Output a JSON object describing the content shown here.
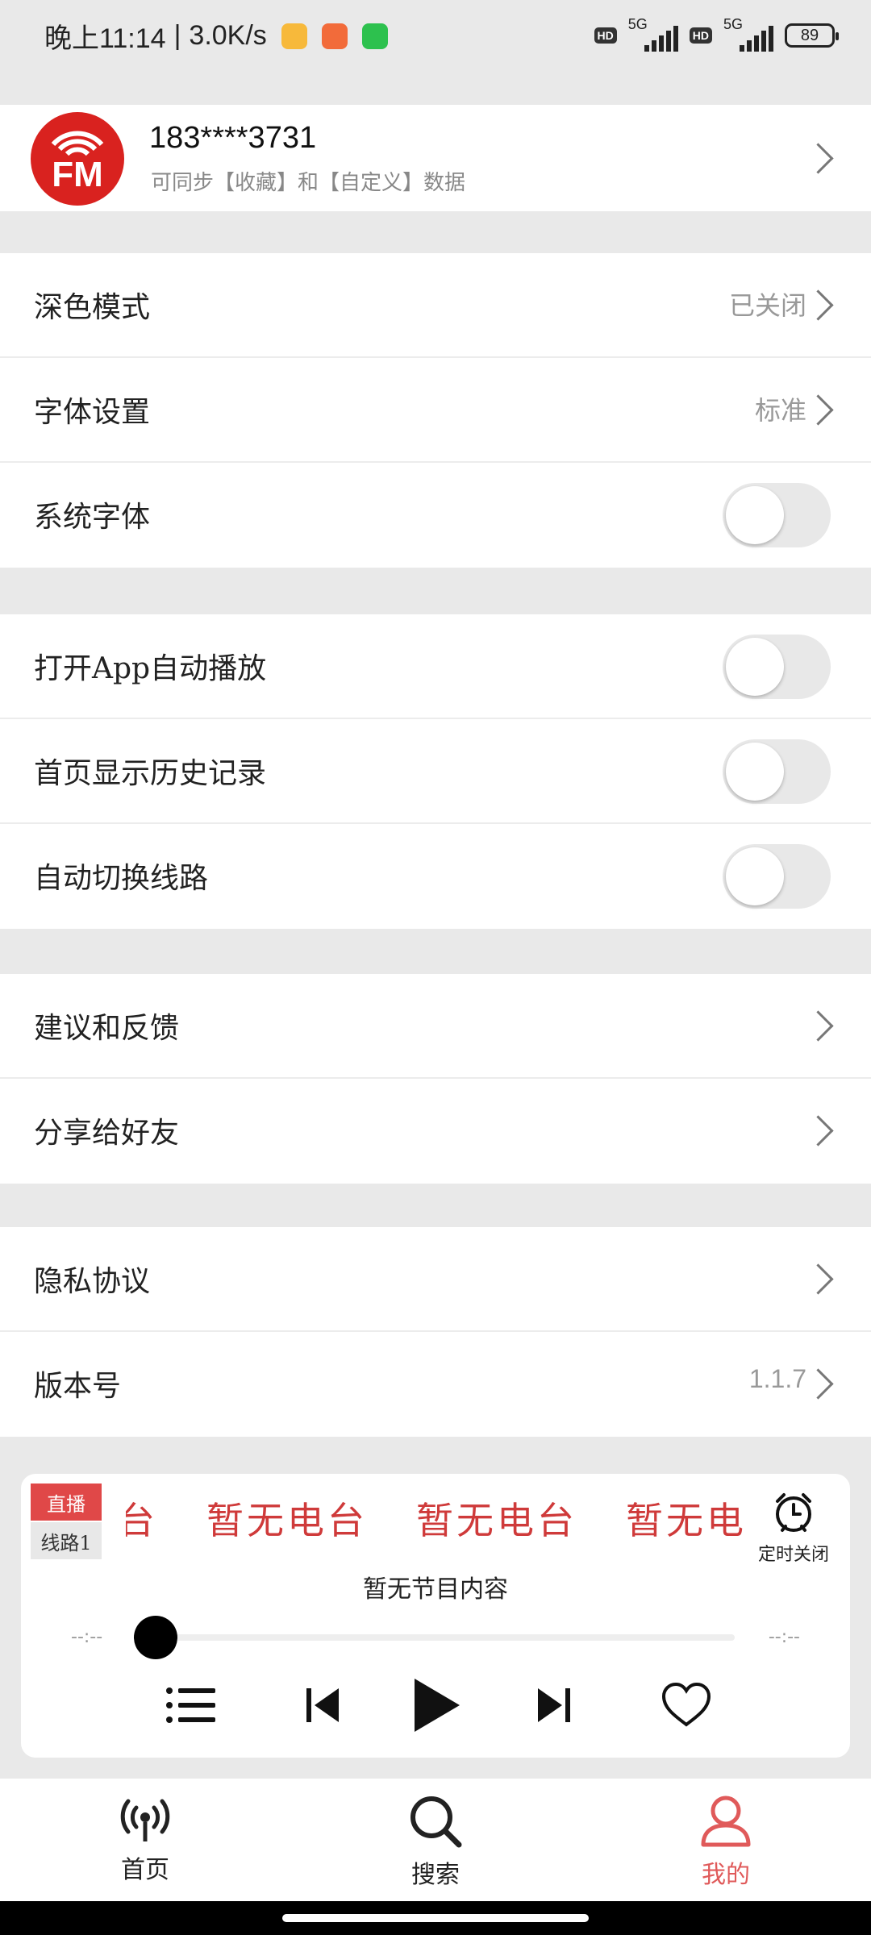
{
  "status_bar": {
    "time": "晚上11:14",
    "speed": "3.0K/s",
    "hd1": "HD",
    "net1": "5G",
    "hd2": "HD",
    "net2": "5G",
    "battery": "89"
  },
  "profile": {
    "logo_text": "FM",
    "phone": "183****3731",
    "subtitle": "可同步【收藏】和【自定义】数据"
  },
  "settings": {
    "dark_mode": {
      "label": "深色模式",
      "value": "已关闭"
    },
    "font_settings": {
      "label": "字体设置",
      "value": "标准"
    },
    "system_font": {
      "label": "系统字体",
      "on": false
    },
    "autoplay": {
      "label": "打开App自动播放",
      "on": false
    },
    "history": {
      "label": "首页显示历史记录",
      "on": false
    },
    "auto_switch": {
      "label": "自动切换线路",
      "on": false
    },
    "feedback": {
      "label": "建议和反馈"
    },
    "share": {
      "label": "分享给好友"
    },
    "privacy": {
      "label": "隐私协议"
    },
    "version": {
      "label": "版本号",
      "value": "1.1.7"
    }
  },
  "player": {
    "live_tag": "直播",
    "line_tag": "线路1",
    "marquee": [
      "台",
      "暂无电台",
      "暂无电台",
      "暂无电台"
    ],
    "timer_label": "定时关闭",
    "program": "暂无节目内容",
    "time_elapsed": "--:--",
    "time_total": "--:--",
    "progress": 0
  },
  "bottom_nav": {
    "home": "首页",
    "search": "搜索",
    "mine": "我的"
  },
  "colors": {
    "accent": "#d9221f",
    "active_nav": "#e05a5a",
    "background": "#e9e9e9"
  }
}
